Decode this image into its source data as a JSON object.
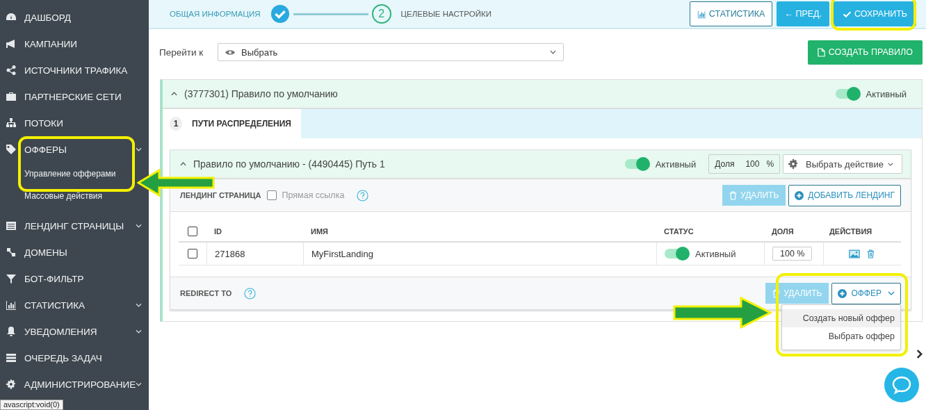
{
  "sidebar": {
    "items": [
      {
        "label": "ДАШБОРД",
        "expandable": false
      },
      {
        "label": "КАМПАНИИ",
        "expandable": false
      },
      {
        "label": "ИСТОЧНИКИ ТРАФИКА",
        "expandable": false
      },
      {
        "label": "ПАРТНЕРСКИЕ СЕТИ",
        "expandable": false
      },
      {
        "label": "ПОТОКИ",
        "expandable": false
      },
      {
        "label": "ОФФЕРЫ",
        "expandable": true,
        "children": [
          {
            "label": "Управление офферами"
          },
          {
            "label": "Массовые действия"
          }
        ]
      },
      {
        "label": "ЛЕНДИНГ СТРАНИЦЫ",
        "expandable": true
      },
      {
        "label": "ДОМЕНЫ",
        "expandable": false
      },
      {
        "label": "БОТ-ФИЛЬТР",
        "expandable": false
      },
      {
        "label": "СТАТИСТИКА",
        "expandable": true
      },
      {
        "label": "УВЕДОМЛЕНИЯ",
        "expandable": true
      },
      {
        "label": "ОЧЕРЕДЬ ЗАДАЧ",
        "expandable": false
      },
      {
        "label": "АДМИНИСТРИРОВАНИЕ",
        "expandable": true
      }
    ]
  },
  "status_tooltip": "avascript:void(0)",
  "steps": [
    {
      "label": "ОБЩАЯ ИНФОРМАЦИЯ",
      "done": true
    },
    {
      "label": "ЦЕЛЕВЫЕ НАСТРОЙКИ",
      "number": "2",
      "done": false
    }
  ],
  "toolbar": [
    {
      "label": "СТАТИСТИКА",
      "kind": "outline"
    },
    {
      "label": "← ПРЕД.",
      "kind": "primary"
    },
    {
      "label": "СОХРАНИТЬ",
      "kind": "save"
    }
  ],
  "goto": {
    "label": "Перейти к",
    "value": "Выбрать"
  },
  "create_rule": "СОЗДАТЬ ПРАВИЛО",
  "rule": {
    "title": "(3777301) Правило по умолчанию",
    "active": {
      "on": true,
      "label": "Активный"
    },
    "tab": {
      "number": "1",
      "label": "ПУТИ РАСПРЕДЕЛЕНИЯ",
      "selected": true
    },
    "path": {
      "title": "Правило по умолчанию - (4490445) Путь 1",
      "active": {
        "on": true,
        "label": "Активный"
      },
      "share_label": "Доля",
      "share_value": "100",
      "share_unit": "%",
      "action": "Выбрать действие",
      "landing": {
        "title": "ЛЕНДИНГ СТРАНИЦА",
        "direct_link": {
          "label": "Прямая ссылка",
          "checked": false
        },
        "delete": {
          "label": "УДАЛИТЬ",
          "disabled": true
        },
        "add": "ДОБАВИТЬ ЛЕНДИНГ"
      },
      "table": {
        "columns": [
          "ID",
          "ИМЯ",
          "СТАТУС",
          "ДОЛЯ",
          "ДЕЙСТВИЯ"
        ],
        "all_checked": false,
        "rows": [
          {
            "checked": false,
            "id": "271868",
            "name": "MyFirstLanding",
            "status": {
              "on": true,
              "label": "Активный"
            },
            "share": "100 %"
          }
        ]
      },
      "redirect": {
        "title": "REDIRECT TO",
        "delete": {
          "label": "УДАЛИТЬ",
          "disabled": true
        },
        "offer": "ОФФЕР",
        "menu": [
          {
            "label": "Создать новый оффер",
            "selected": true
          },
          {
            "label": "Выбрать оффер",
            "selected": false
          }
        ]
      }
    }
  }
}
